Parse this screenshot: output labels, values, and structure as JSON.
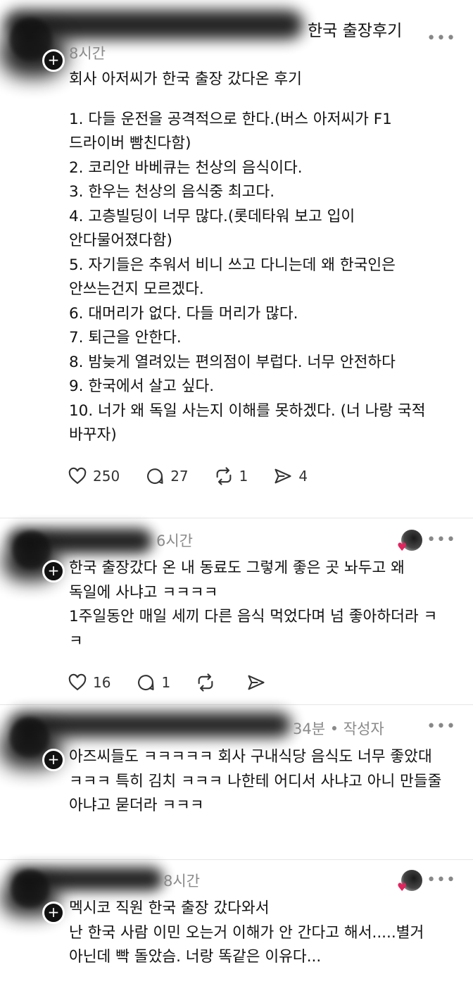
{
  "posts": [
    {
      "title_fragment": "한국 출장후기",
      "time": "8시간",
      "lines": [
        "회사 아저씨가 한국 출장 갔다온 후기",
        "",
        "1. 다들 운전을 공격적으로 한다.(버스 아저씨가 F1",
        "드라이버 빰친다함)",
        "2. 코리안 바베큐는 천상의 음식이다.",
        "3. 한우는 천상의 음식중 최고다.",
        "4. 고층빌딩이 너무 많다.(롯데타워 보고 입이",
        "안다물어졌다함)",
        "5. 자기들은 추워서 비니 쓰고 다니는데 왜 한국인은",
        "안쓰는건지 모르겠다.",
        "6. 대머리가 없다. 다들 머리가 많다.",
        "7. 퇴근을 안한다.",
        "8. 밤늦게 열려있는 편의점이 부럽다. 너무 안전하다",
        "9. 한국에서 살고 싶다.",
        "10. 너가 왜 독일 사는지 이해를 못하겠다. (너 나랑 국적",
        "바꾸자)"
      ],
      "likes": "250",
      "comments": "27",
      "reposts": "1",
      "shares": "4"
    },
    {
      "time": "6시간",
      "lines": [
        "한국 출장갔다 온 내 동료도 그렇게 좋은 곳 놔두고 왜",
        "독일에 사냐고 ㅋㅋㅋㅋ",
        "1주일동안 매일 세끼 다른 음식 먹었다며 넘 좋아하더라 ㅋ",
        "ㅋ"
      ],
      "likes": "16",
      "comments": "1"
    },
    {
      "time": "34분 • 작성자",
      "lines": [
        "아즈씨들도 ㅋㅋㅋㅋㅋ 회사 구내식당 음식도 너무 좋았대",
        "ㅋㅋㅋ 특히 김치 ㅋㅋㅋ 나한테 어디서 사냐고 아니 만들줄",
        "아냐고 묻더라 ㅋㅋㅋ"
      ]
    },
    {
      "time": "8시간",
      "lines": [
        "멕시코 직원 한국 출장 갔다와서",
        "난 한국 사람 이민 오는거 이해가 안 간다고 해서.....별거",
        "아닌데 빡 돌았슴. 너랑 똑같은 이유다..."
      ]
    }
  ],
  "more_label": "•••",
  "plus_label": "+",
  "colors": {
    "heart": "#e0245e",
    "muted": "#8a8a8a"
  },
  "icons": [
    "heart-icon",
    "comment-icon",
    "repost-icon",
    "share-icon",
    "more-icon",
    "follow-plus-icon"
  ]
}
